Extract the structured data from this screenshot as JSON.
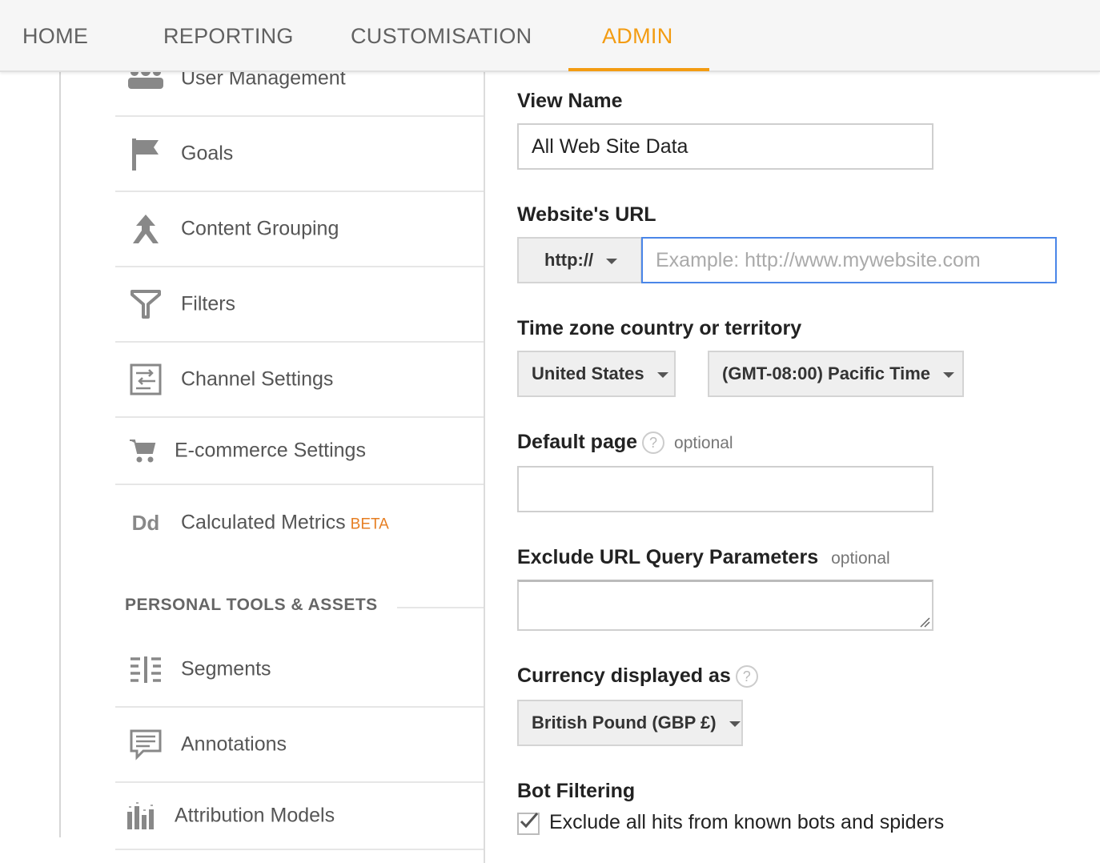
{
  "nav": {
    "tabs": [
      {
        "label": "HOME",
        "active": false
      },
      {
        "label": "REPORTING",
        "active": false
      },
      {
        "label": "CUSTOMISATION",
        "active": false
      },
      {
        "label": "ADMIN",
        "active": true
      }
    ],
    "accent_color": "#f39c12"
  },
  "sidebar": {
    "items": [
      {
        "label": "User Management",
        "icon": "users-icon"
      },
      {
        "label": "Goals",
        "icon": "flag-icon"
      },
      {
        "label": "Content Grouping",
        "icon": "content-grouping-icon"
      },
      {
        "label": "Filters",
        "icon": "filter-icon"
      },
      {
        "label": "Channel Settings",
        "icon": "channel-settings-icon"
      },
      {
        "label": "E-commerce Settings",
        "icon": "cart-icon"
      },
      {
        "label": "Calculated Metrics",
        "badge": "BETA",
        "icon": "calculated-metrics-icon",
        "icon_text": "Dd"
      }
    ],
    "section_title": "PERSONAL TOOLS & ASSETS",
    "personal_items": [
      {
        "label": "Segments",
        "icon": "segments-icon"
      },
      {
        "label": "Annotations",
        "icon": "annotations-icon"
      },
      {
        "label": "Attribution Models",
        "icon": "attribution-icon"
      }
    ]
  },
  "form": {
    "view_name": {
      "label": "View Name",
      "value": "All Web Site Data"
    },
    "website_url": {
      "label": "Website's URL",
      "protocol": "http://",
      "placeholder": "Example: http://www.mywebsite.com"
    },
    "timezone": {
      "label": "Time zone country or territory",
      "country": "United States",
      "zone": "(GMT-08:00) Pacific Time"
    },
    "default_page": {
      "label": "Default page",
      "help": "?",
      "optional": "optional",
      "value": ""
    },
    "exclude_params": {
      "label": "Exclude URL Query Parameters",
      "optional": "optional",
      "value": ""
    },
    "currency": {
      "label": "Currency displayed as",
      "help": "?",
      "value": "British Pound (GBP £)"
    },
    "bot_filtering": {
      "label": "Bot Filtering",
      "checkbox_label": "Exclude all hits from known bots and spiders",
      "checked": true
    }
  }
}
